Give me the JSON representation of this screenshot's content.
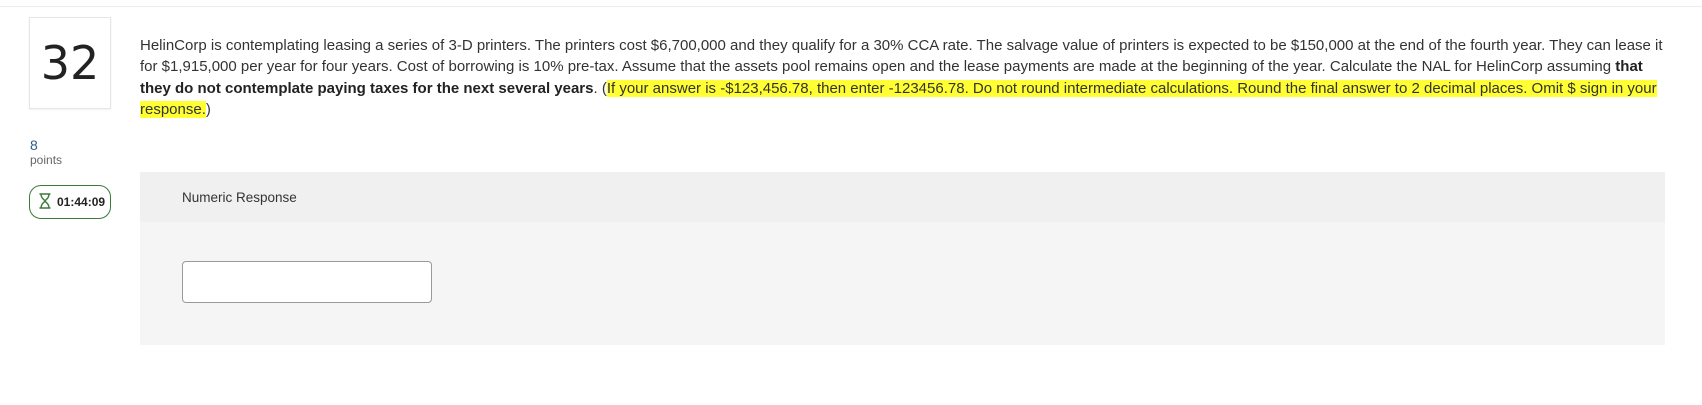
{
  "question": {
    "number": "32",
    "points_value": "8",
    "points_label": "points",
    "timer": "01:44:09",
    "text_plain_1": "HelinCorp is contemplating leasing a series of 3-D printers. The printers cost $6,700,000 and they qualify for a 30% CCA rate. The salvage value of printers is expected to be $150,000 at the end of the fourth year. They can lease it for $1,915,000 per year for four years. Cost of borrowing is 10% pre-tax. Assume that the assets pool remains open and the lease payments are made at the beginning of the year. Calculate the NAL for HelinCorp assuming ",
    "text_bold": "that they do not contemplate paying taxes for the next several years",
    "text_plain_2": ". (",
    "text_highlight": "If your answer is -$123,456.78, then enter -123456.78. Do not round intermediate calculations. Round the final answer to 2 decimal places. Omit $ sign in your response.",
    "text_plain_3": ")"
  },
  "response": {
    "header": "Numeric Response",
    "input_value": ""
  },
  "colors": {
    "highlight": "#ffff33",
    "timer_border": "#3a7a3a",
    "points_value": "#2a5d8a"
  },
  "icons": {
    "timer": "hourglass-icon"
  }
}
